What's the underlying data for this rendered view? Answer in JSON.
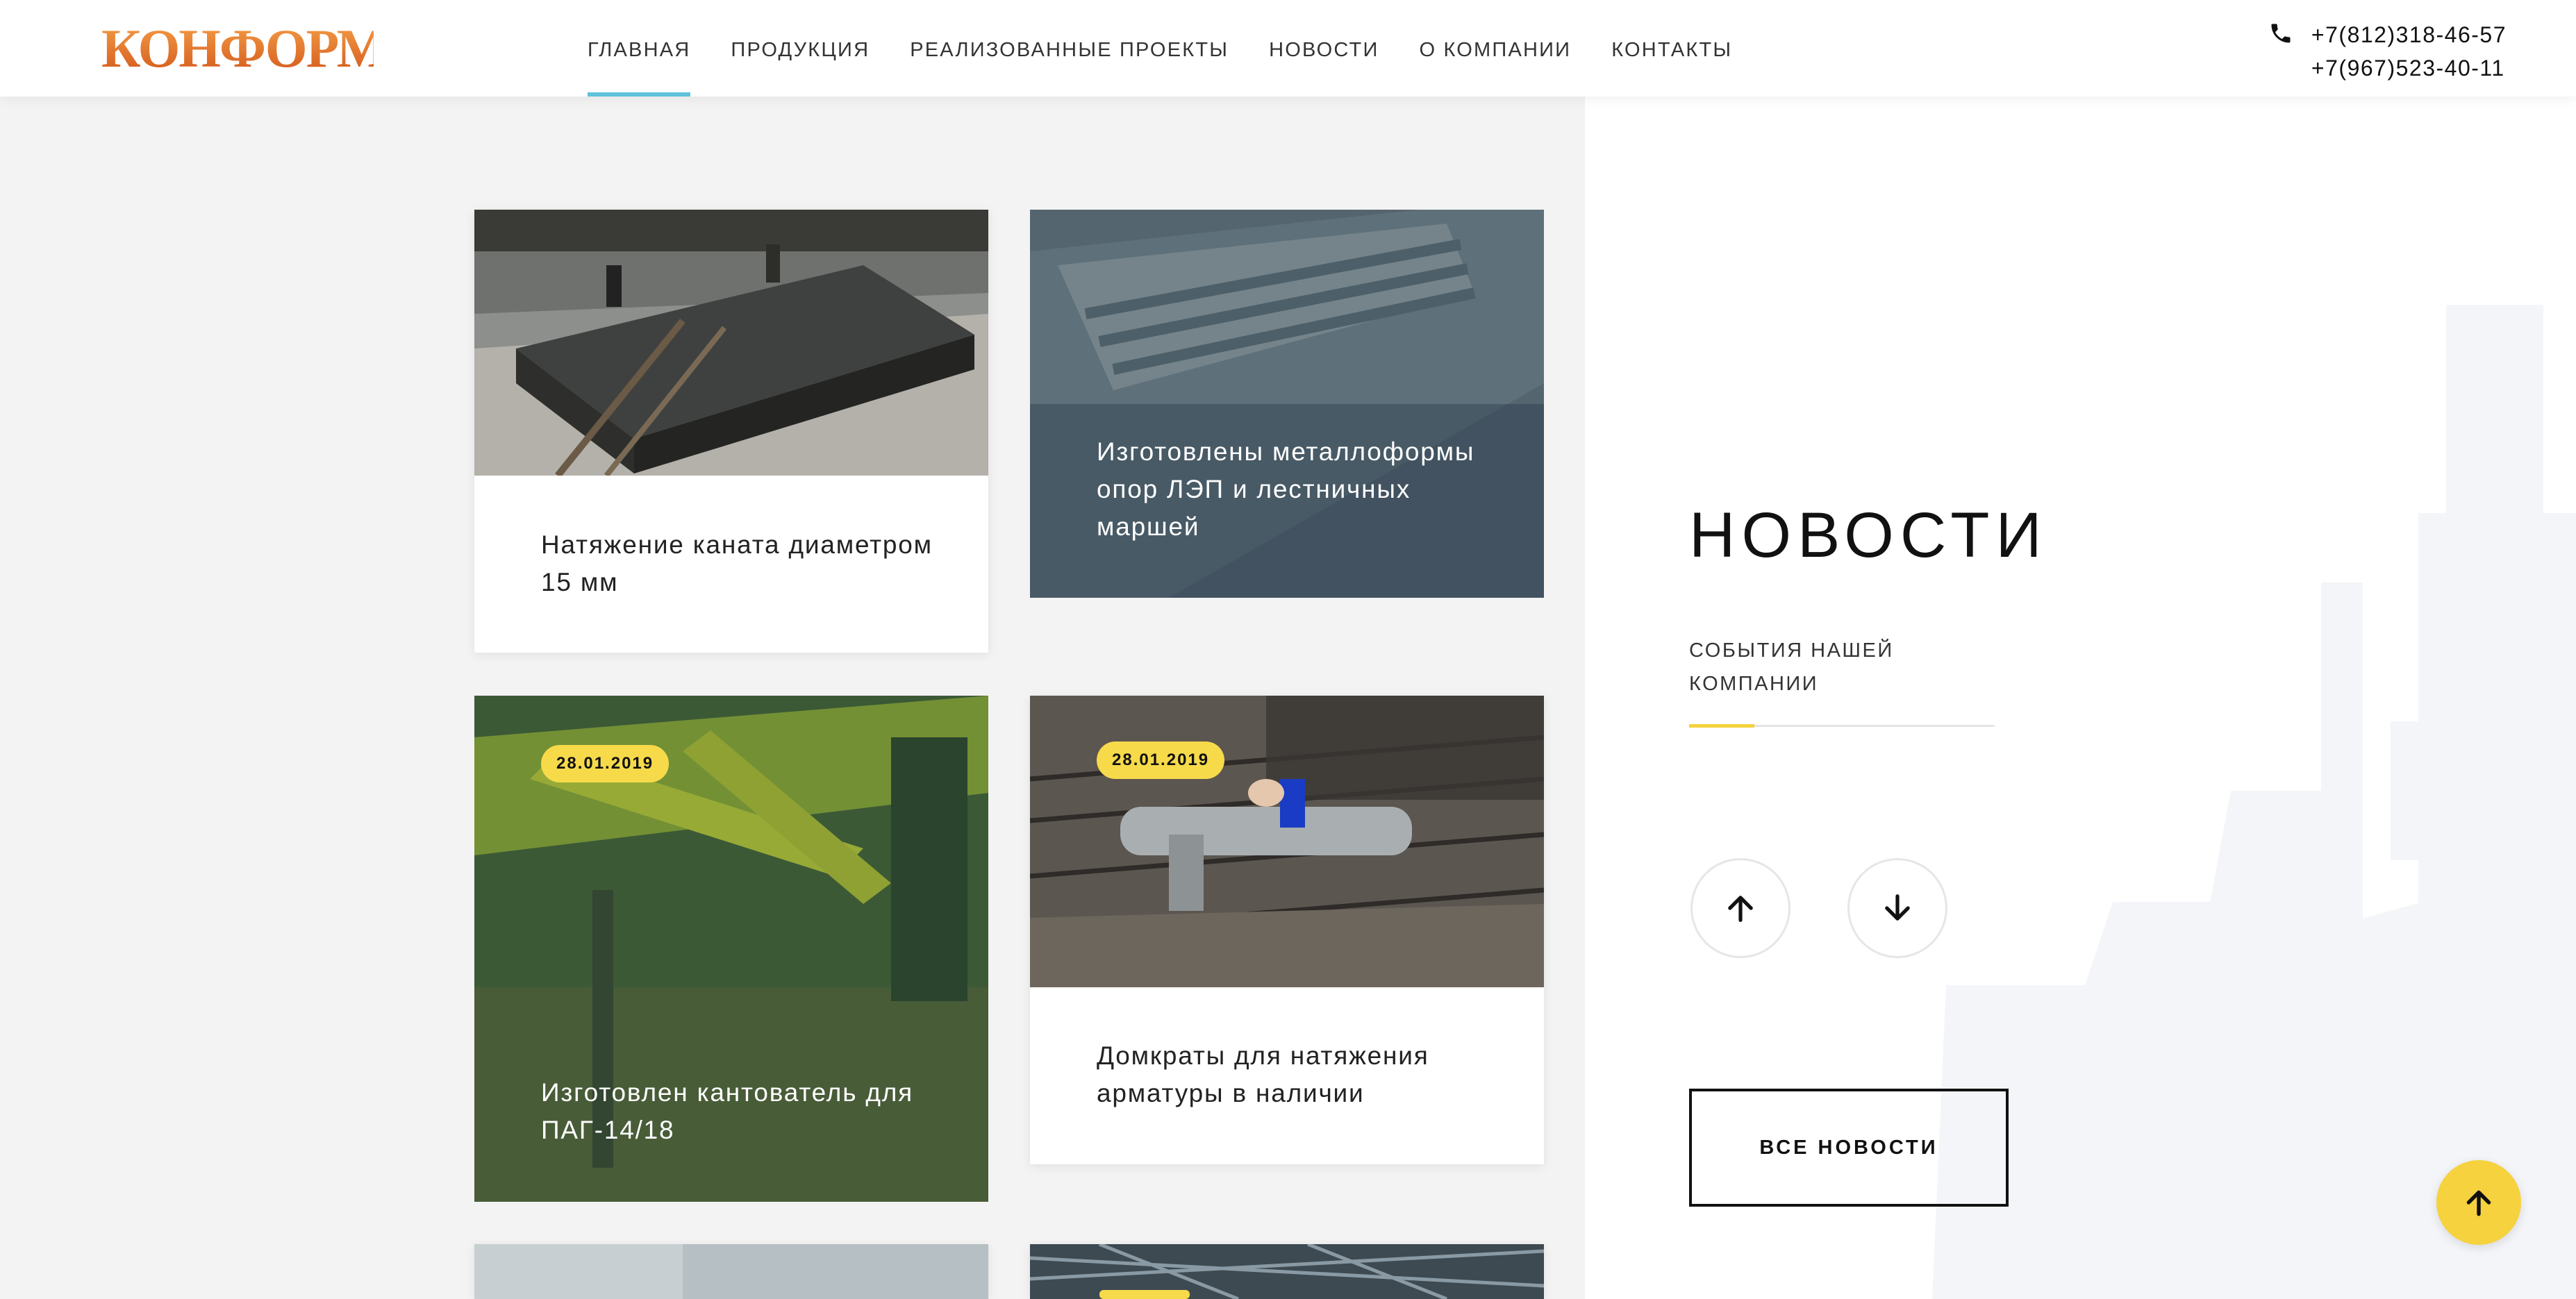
{
  "header": {
    "logo_text": "КОНФОРМ",
    "nav": [
      {
        "label": "ГЛАВНАЯ",
        "active": true
      },
      {
        "label": "ПРОДУКЦИЯ",
        "active": false
      },
      {
        "label": "РЕАЛИЗОВАННЫЕ ПРОЕКТЫ",
        "active": false
      },
      {
        "label": "НОВОСТИ",
        "active": false
      },
      {
        "label": "О КОМПАНИИ",
        "active": false
      },
      {
        "label": "КОНТАКТЫ",
        "active": false
      }
    ],
    "phones": [
      "+7(812)318-46-57",
      "+7(967)523-40-11"
    ]
  },
  "news_cards": [
    {
      "title": "Натяжение каната диаметром 15 мм",
      "date": ""
    },
    {
      "title": "Изготовлены металлоформы опор ЛЭП и лестничных маршей",
      "date": ""
    },
    {
      "title": "Изготовлен кантователь для ПАГ-14/18",
      "date": "28.01.2019"
    },
    {
      "title": "Домкраты для натяжения арматуры в наличии",
      "date": "28.01.2019"
    }
  ],
  "side": {
    "title": "НОВОСТИ",
    "subtitle": "СОБЫТИЯ НАШЕЙ КОМПАНИИ",
    "all_news_label": "ВСЕ НОВОСТИ"
  },
  "colors": {
    "accent_blue": "#5fc2db",
    "accent_yellow": "#f5d23e",
    "logo_orange": "#e8741f"
  },
  "icons": [
    "phone-icon",
    "arrow-up-icon",
    "arrow-down-icon",
    "scroll-top-icon"
  ]
}
